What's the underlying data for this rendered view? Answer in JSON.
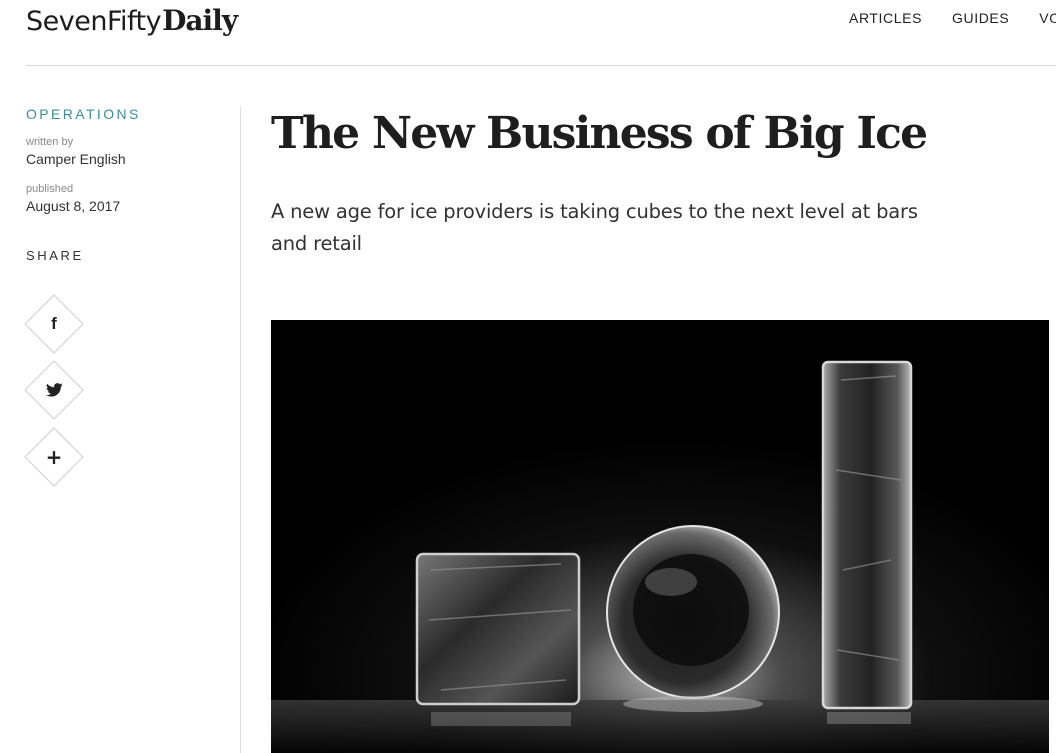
{
  "header": {
    "logo_light": "SevenFifty",
    "logo_bold": "Daily",
    "nav": [
      {
        "label": "ARTICLES"
      },
      {
        "label": "GUIDES"
      },
      {
        "label": "VOI"
      }
    ]
  },
  "sidebar": {
    "category": "OPERATIONS",
    "written_by_label": "written by",
    "author": "Camper English",
    "published_label": "published",
    "date": "August 8, 2017",
    "share_label": "SHARE",
    "share_buttons": [
      {
        "icon": "facebook-icon",
        "glyph": "f"
      },
      {
        "icon": "twitter-icon"
      },
      {
        "icon": "plus-icon",
        "glyph": "+"
      }
    ]
  },
  "article": {
    "title": "The New Business of Big Ice",
    "dek": "A new age for ice providers is taking cubes to the next level at bars and retail",
    "hero_image": "ice-cube-sphere-column-photo"
  }
}
